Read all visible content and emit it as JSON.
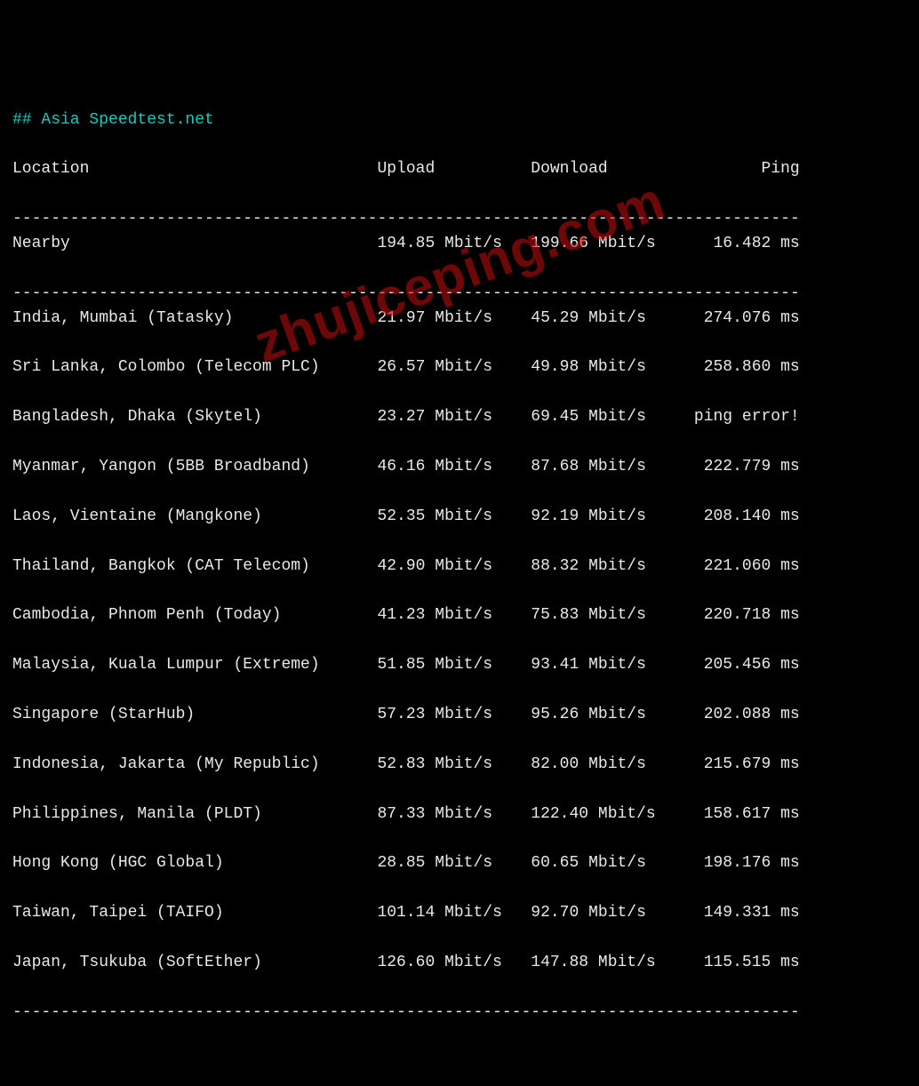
{
  "title": "## Asia Speedtest.net",
  "headers": {
    "location": "Location",
    "upload": "Upload",
    "download": "Download",
    "ping": "Ping"
  },
  "separator": "----------------------------------------------------------------------------------",
  "nearby": {
    "location": "Nearby",
    "upload": "194.85 Mbit/s",
    "download": "199.66 Mbit/s",
    "ping": "16.482 ms"
  },
  "rows": [
    {
      "location": "India, Mumbai (Tatasky)",
      "upload": "21.97 Mbit/s",
      "download": "45.29 Mbit/s",
      "ping": "274.076 ms"
    },
    {
      "location": "Sri Lanka, Colombo (Telecom PLC)",
      "upload": "26.57 Mbit/s",
      "download": "49.98 Mbit/s",
      "ping": "258.860 ms"
    },
    {
      "location": "Bangladesh, Dhaka (Skytel)",
      "upload": "23.27 Mbit/s",
      "download": "69.45 Mbit/s",
      "ping": "ping error!"
    },
    {
      "location": "Myanmar, Yangon (5BB Broadband)",
      "upload": "46.16 Mbit/s",
      "download": "87.68 Mbit/s",
      "ping": "222.779 ms"
    },
    {
      "location": "Laos, Vientaine (Mangkone)",
      "upload": "52.35 Mbit/s",
      "download": "92.19 Mbit/s",
      "ping": "208.140 ms"
    },
    {
      "location": "Thailand, Bangkok (CAT Telecom)",
      "upload": "42.90 Mbit/s",
      "download": "88.32 Mbit/s",
      "ping": "221.060 ms"
    },
    {
      "location": "Cambodia, Phnom Penh (Today)",
      "upload": "41.23 Mbit/s",
      "download": "75.83 Mbit/s",
      "ping": "220.718 ms"
    },
    {
      "location": "Malaysia, Kuala Lumpur (Extreme)",
      "upload": "51.85 Mbit/s",
      "download": "93.41 Mbit/s",
      "ping": "205.456 ms"
    },
    {
      "location": "Singapore (StarHub)",
      "upload": "57.23 Mbit/s",
      "download": "95.26 Mbit/s",
      "ping": "202.088 ms"
    },
    {
      "location": "Indonesia, Jakarta (My Republic)",
      "upload": "52.83 Mbit/s",
      "download": "82.00 Mbit/s",
      "ping": "215.679 ms"
    },
    {
      "location": "Philippines, Manila (PLDT)",
      "upload": "87.33 Mbit/s",
      "download": "122.40 Mbit/s",
      "ping": "158.617 ms"
    },
    {
      "location": "Hong Kong (HGC Global)",
      "upload": "28.85 Mbit/s",
      "download": "60.65 Mbit/s",
      "ping": "198.176 ms"
    },
    {
      "location": "Taiwan, Taipei (TAIFO)",
      "upload": "101.14 Mbit/s",
      "download": "92.70 Mbit/s",
      "ping": "149.331 ms"
    },
    {
      "location": "Japan, Tsukuba (SoftEther)",
      "upload": "126.60 Mbit/s",
      "download": "147.88 Mbit/s",
      "ping": "115.515 ms"
    }
  ],
  "watermark": "zhujiceping.com"
}
